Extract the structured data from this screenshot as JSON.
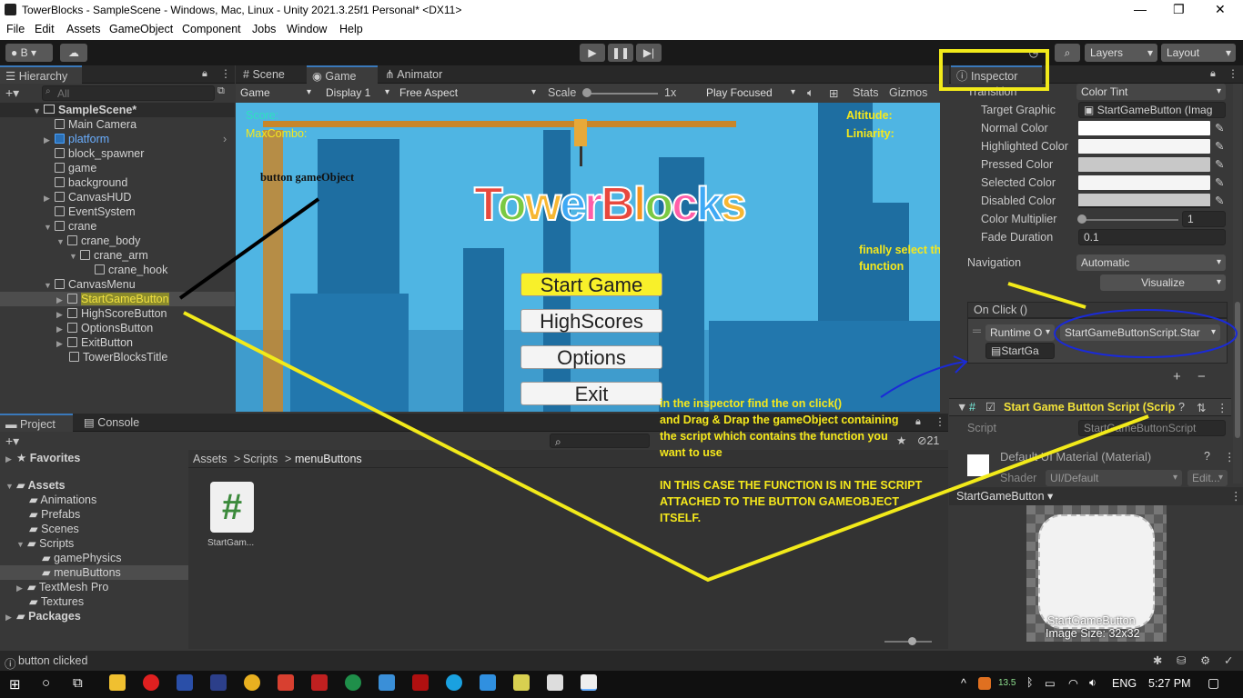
{
  "window": {
    "title": "TowerBlocks - SampleScene - Windows, Mac, Linux - Unity 2021.3.25f1 Personal* <DX11>",
    "minimize": "—",
    "restore": "❐",
    "close": "✕"
  },
  "menu": [
    "File",
    "Edit",
    "Assets",
    "GameObject",
    "Component",
    "Jobs",
    "Window",
    "Help"
  ],
  "toolbar": {
    "account": "B",
    "layers": "Layers",
    "layout": "Layout"
  },
  "hierarchy": {
    "tab": "Hierarchy",
    "search_placeholder": "All",
    "scene": "SampleScene*",
    "items": [
      "Main Camera",
      "platform",
      "block_spawner",
      "game",
      "background",
      "CanvasHUD",
      "EventSystem",
      "crane",
      "crane_body",
      "crane_arm",
      "crane_hook",
      "CanvasMenu",
      "StartGameButton",
      "HighScoreButton",
      "OptionsButton",
      "ExitButton",
      "TowerBlocksTitle"
    ]
  },
  "view_tabs": [
    "Scene",
    "Game",
    "Animator"
  ],
  "game_toolbar": {
    "mode": "Game",
    "display": "Display 1",
    "aspect": "Free Aspect",
    "scale_label": "Scale",
    "scale_value": "1x",
    "play_focused": "Play Focused",
    "stats": "Stats",
    "gizmos": "Gizmos"
  },
  "game": {
    "score": "Score:",
    "maxcombo": "MaxCombo:",
    "altitude": "Altitude:",
    "liniarity": "Liniarity:",
    "logo": [
      "T",
      "o",
      "w",
      "e",
      "r",
      "B",
      "l",
      "o",
      "c",
      "k",
      "s"
    ],
    "logo_colors": [
      "#e8493e",
      "#7ac943",
      "#f7b733",
      "#3fa9f5",
      "#ff5ea8",
      "#e8493e",
      "#f7931e",
      "#7ac943",
      "#ff5ea8",
      "#3fa9f5",
      "#f7b733"
    ],
    "buttons": [
      "Start Game",
      "HighScores",
      "Options",
      "Exit"
    ]
  },
  "annotations": {
    "button_gameobject": "button gameObject",
    "finally_select": [
      "finally select the",
      "function"
    ],
    "instructions": [
      "in the inspector find the on click()",
      "and Drag & Drap the gameObject containing",
      "the script which contains the function you",
      "want to use",
      "",
      "IN THIS CASE THE FUNCTION IS IN THE SCRIPT",
      "ATTACHED TO THE BUTTON GAMEOBJECT",
      "ITSELF."
    ]
  },
  "inspector": {
    "tab": "Inspector",
    "transition_label": "Transition",
    "transition_value": "Color Tint",
    "rows": [
      {
        "label": "Target Graphic",
        "value": "StartGameButton (Imag"
      },
      {
        "label": "Normal Color"
      },
      {
        "label": "Highlighted Color"
      },
      {
        "label": "Pressed Color"
      },
      {
        "label": "Selected Color"
      },
      {
        "label": "Disabled Color"
      },
      {
        "label": "Color Multiplier",
        "value": "1"
      },
      {
        "label": "Fade Duration",
        "value": "0.1"
      }
    ],
    "navigation_label": "Navigation",
    "navigation_value": "Automatic",
    "visualize": "Visualize",
    "onclick_label": "On Click ()",
    "runtime": "Runtime O",
    "function": "StartGameButtonScript.Star",
    "object": "StartGa",
    "plus": "+",
    "minus": "−",
    "script_component": "Start Game Button Script (Scrip",
    "script_label": "Script",
    "script_value": "StartGameButtonScript",
    "material": "Default UI Material (Material)",
    "shader_label": "Shader",
    "shader_value": "UI/Default",
    "edit": "Edit...",
    "preview_name": "StartGameButton",
    "preview_caption": "StartGameButton",
    "preview_size": "Image Size: 32x32"
  },
  "project": {
    "tabs": [
      "Project",
      "Console"
    ],
    "count": "21",
    "favorites": "Favorites",
    "tree": [
      "Assets",
      "Animations",
      "Prefabs",
      "Scenes",
      "Scripts",
      "gamePhysics",
      "menuButtons",
      "TextMesh Pro",
      "Textures",
      "Packages"
    ],
    "breadcrumb": [
      "Assets",
      "Scripts",
      "menuButtons"
    ],
    "file_name": "StartGam..."
  },
  "status": "button clicked",
  "taskbar": {
    "temp": "13.5",
    "lang": "ENG",
    "time": "5:27 PM"
  }
}
